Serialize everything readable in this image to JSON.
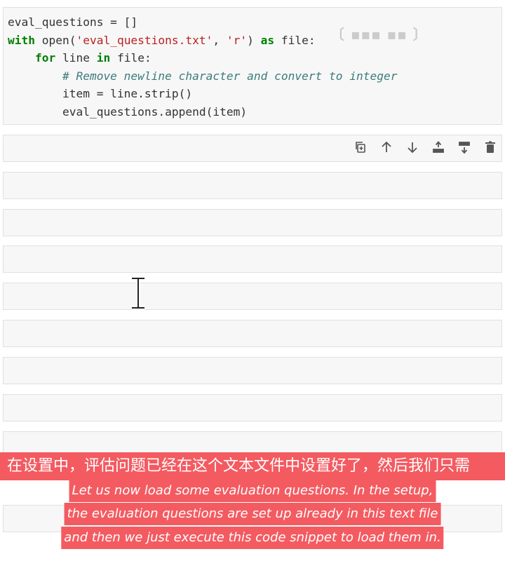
{
  "code_cell": {
    "line1": "eval_questions = []",
    "line2_kw": "with",
    "line2_a": " open(",
    "line2_str1": "'eval_questions.txt'",
    "line2_b": ", ",
    "line2_str2": "'r'",
    "line2_c": ") ",
    "line2_kw2": "as",
    "line2_d": " file:",
    "line3_indent": "    ",
    "line3_kw": "for",
    "line3_a": " line ",
    "line3_kw2": "in",
    "line3_b": " file:",
    "line4": "        # Remove newline character and convert to integer",
    "line5": "        item = line.strip()",
    "line6": "        eval_questions.append(item)"
  },
  "cell_toolbar": {
    "icons": [
      "duplicate-icon",
      "move-up-icon",
      "move-down-icon",
      "insert-above-icon",
      "insert-below-icon",
      "delete-icon"
    ]
  },
  "subtitles": {
    "chinese": "在设置中，评估问题已经在这个文本文件中设置好了，然后我们只需",
    "english_line1": "Let us now load some evaluation questions. In the setup,",
    "english_line2": "the evaluation questions are set up already in this text file",
    "english_line3": "and then we just execute this code snippet to load them in."
  },
  "colors": {
    "subtitle_bg": "#f35b61",
    "cell_bg": "#f7f7f7",
    "keyword": "#008000",
    "string": "#ba2121",
    "comment": "#3d7b7b"
  }
}
